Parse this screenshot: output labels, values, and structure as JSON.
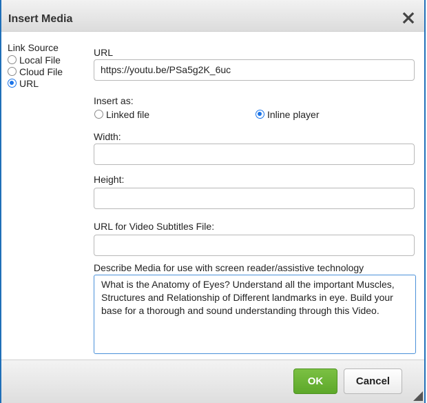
{
  "dialog": {
    "title": "Insert Media",
    "close_icon": "close-icon"
  },
  "link_source": {
    "label": "Link Source",
    "options": [
      {
        "label": "Local File",
        "checked": false
      },
      {
        "label": "Cloud File",
        "checked": false
      },
      {
        "label": "URL",
        "checked": true
      }
    ]
  },
  "url": {
    "label": "URL",
    "value": "https://youtu.be/PSa5g2K_6uc"
  },
  "insert_as": {
    "label": "Insert as:",
    "options": [
      {
        "label": "Linked file",
        "checked": false
      },
      {
        "label": "Inline player",
        "checked": true
      }
    ]
  },
  "width": {
    "label": "Width:",
    "value": ""
  },
  "height": {
    "label": "Height:",
    "value": ""
  },
  "subtitles": {
    "label": "URL for Video Subtitles File:",
    "value": ""
  },
  "description": {
    "label": "Describe Media for use with screen reader/assistive technology",
    "value": "What is the Anatomy of Eyes? Understand all the important Muscles, Structures and Relationship of Different landmarks in eye. Build your base for a thorough and sound understanding through this Video."
  },
  "footer": {
    "ok_label": "OK",
    "cancel_label": "Cancel"
  },
  "colors": {
    "accent": "#1a73e8",
    "ok_green": "#6cb535",
    "border_blue": "#1f6fb8"
  }
}
